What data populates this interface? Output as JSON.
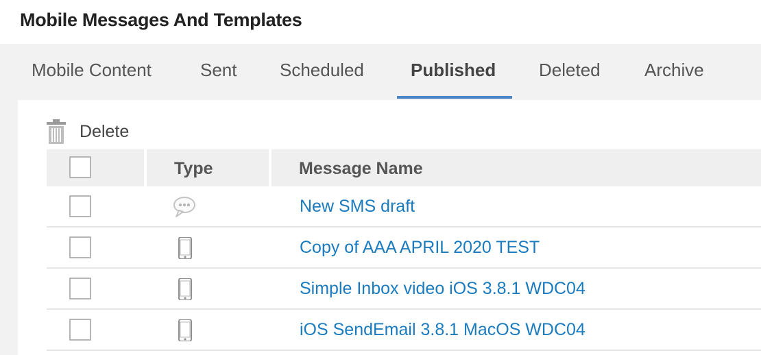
{
  "page": {
    "title": "Mobile Messages And Templates"
  },
  "tabs": [
    {
      "label": "Mobile Content",
      "active": false
    },
    {
      "label": "Sent",
      "active": false
    },
    {
      "label": "Scheduled",
      "active": false
    },
    {
      "label": "Published",
      "active": true
    },
    {
      "label": "Deleted",
      "active": false
    },
    {
      "label": "Archive",
      "active": false
    }
  ],
  "toolbar": {
    "delete_label": "Delete",
    "delete_icon": "trash-icon"
  },
  "table": {
    "columns": {
      "type": "Type",
      "name": "Message Name"
    },
    "rows": [
      {
        "type_icon": "sms-bubble-icon",
        "name": "New SMS draft"
      },
      {
        "type_icon": "mobile-phone-icon",
        "name": "Copy of AAA APRIL 2020 TEST"
      },
      {
        "type_icon": "mobile-phone-icon",
        "name": "Simple Inbox video iOS 3.8.1 WDC04"
      },
      {
        "type_icon": "mobile-phone-icon",
        "name": "iOS SendEmail 3.8.1 MacOS WDC04"
      }
    ]
  },
  "colors": {
    "accent": "#4a84c4",
    "link": "#1a7bbf",
    "tab_bg": "#f2f2f2"
  }
}
